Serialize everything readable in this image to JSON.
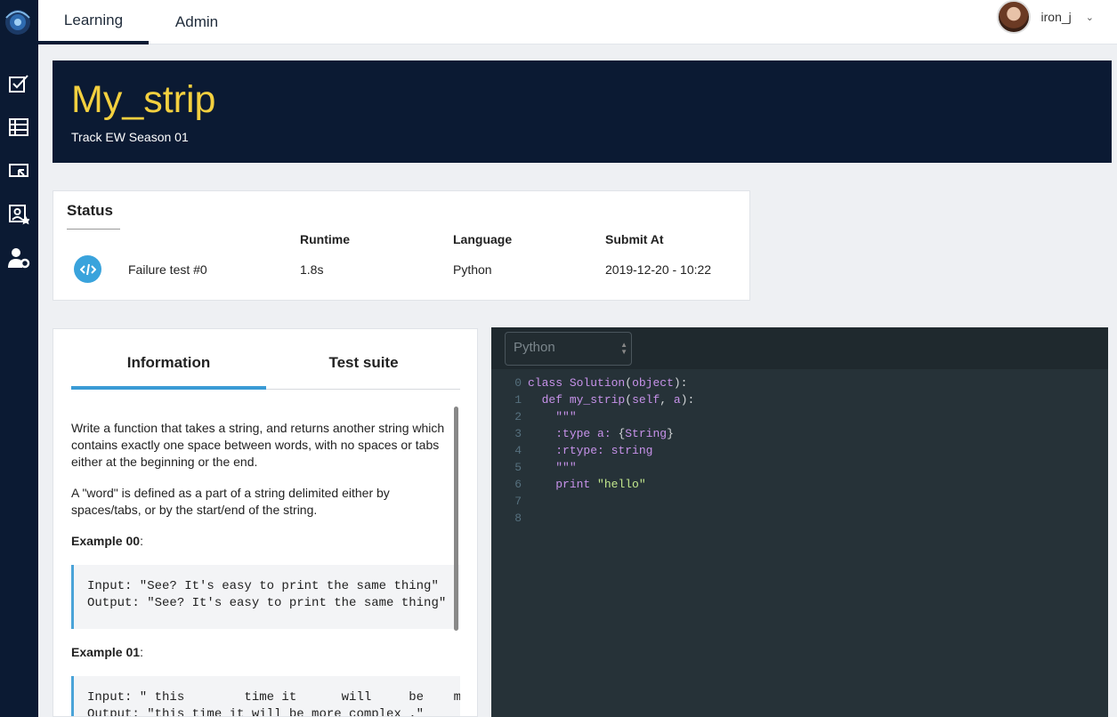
{
  "nav": {
    "tabs": [
      {
        "label": "Learning",
        "active": true
      },
      {
        "label": "Admin",
        "active": false
      }
    ],
    "user": {
      "name": "iron_j"
    }
  },
  "sidebar": {
    "icons": [
      "checkbox-icon",
      "list-icon",
      "presentation-icon",
      "profile-star-icon",
      "user-settings-icon"
    ]
  },
  "header": {
    "title": "My_strip",
    "subtitle": "Track EW Season 01"
  },
  "status": {
    "heading": "Status",
    "columns": {
      "runtime": "Runtime",
      "language": "Language",
      "submit_at": "Submit At"
    },
    "row": {
      "result": "Failure test #0",
      "runtime": "1.8s",
      "language": "Python",
      "submit_at": "2019-12-20 - 10:22"
    }
  },
  "info": {
    "tabs": [
      {
        "label": "Information",
        "active": true
      },
      {
        "label": "Test suite",
        "active": false
      }
    ],
    "description_1": "Write a function that takes a string, and returns another string which contains exactly one space between words, with no spaces or tabs either at the beginning or the end.",
    "description_2": "A \"word\" is defined as a part of a string delimited either by spaces/tabs, or by the start/end of the string.",
    "example_00_label": "Example 00",
    "example_00_code": "Input: \"See? It's easy to print the same thing\"\nOutput: \"See? It's easy to print the same thing\"",
    "example_01_label": "Example 01",
    "example_01_code": "Input: \" this        time it      will     be    mo\nOutput: \"this time it will be more complex .\""
  },
  "editor": {
    "language": "Python",
    "line_numbers": [
      "0",
      "1",
      "2",
      "3",
      "4",
      "5",
      "6",
      "7",
      "8"
    ]
  },
  "colors": {
    "navy": "#0b1a33",
    "title_yellow": "#f4d03f",
    "accent_blue": "#3a9bd5",
    "editor_bg": "#263238"
  }
}
